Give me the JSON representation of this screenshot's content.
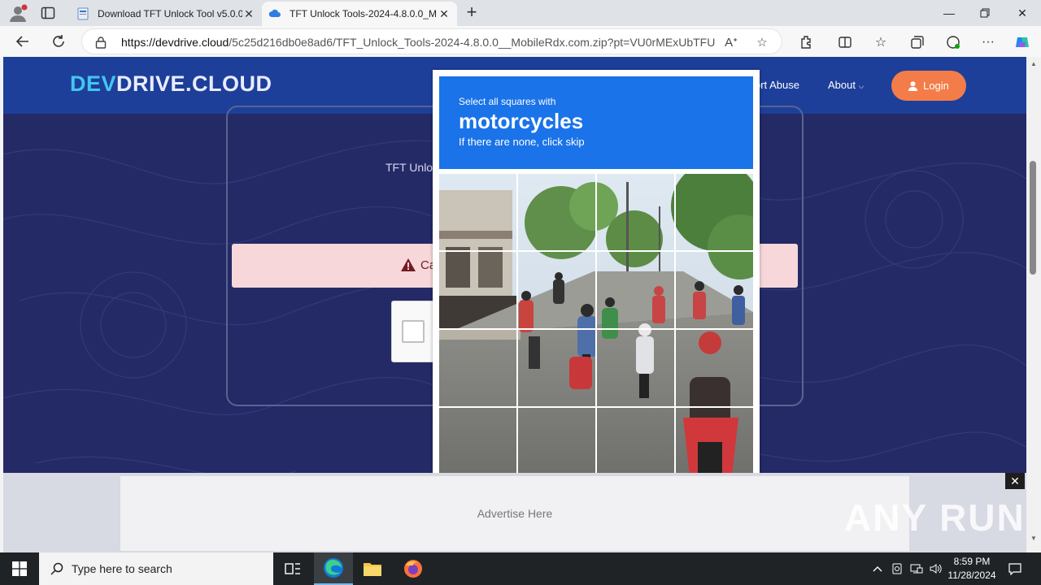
{
  "browser": {
    "tabs": [
      {
        "title": "Download TFT Unlock Tool v5.0.0",
        "active": false
      },
      {
        "title": "TFT Unlock Tools-2024-4.8.0.0_M",
        "active": true
      }
    ],
    "url_host": "https://devdrive.cloud",
    "url_path": "/5c25d216db0e8ad6/TFT_Unlock_Tools-2024-4.8.0.0__MobileRdx.com.zip?pt=VU0rMExUbTFU..."
  },
  "site": {
    "logo_prefix": "DEV",
    "logo_suffix": "DRIVE.CLOUD",
    "nav": {
      "report": "ort Abuse",
      "about": "About"
    },
    "login_label": "Login",
    "card_text": "TFT Unloc",
    "alert_text": "Ca",
    "ad_text": "Advertise Here",
    "ad_close": "✕",
    "watermark": "ANY RUN"
  },
  "challenge": {
    "instruction": "Select all squares with",
    "target": "motorcycles",
    "hint": "If there are none, click skip"
  },
  "taskbar": {
    "search_placeholder": "Type here to search",
    "time": "8:59 PM",
    "date": "11/28/2024"
  },
  "colors": {
    "page_bg": "#242a66",
    "header_bg": "#1d3f9a",
    "login": "#f47c48",
    "captcha_blue": "#1a73e8"
  }
}
